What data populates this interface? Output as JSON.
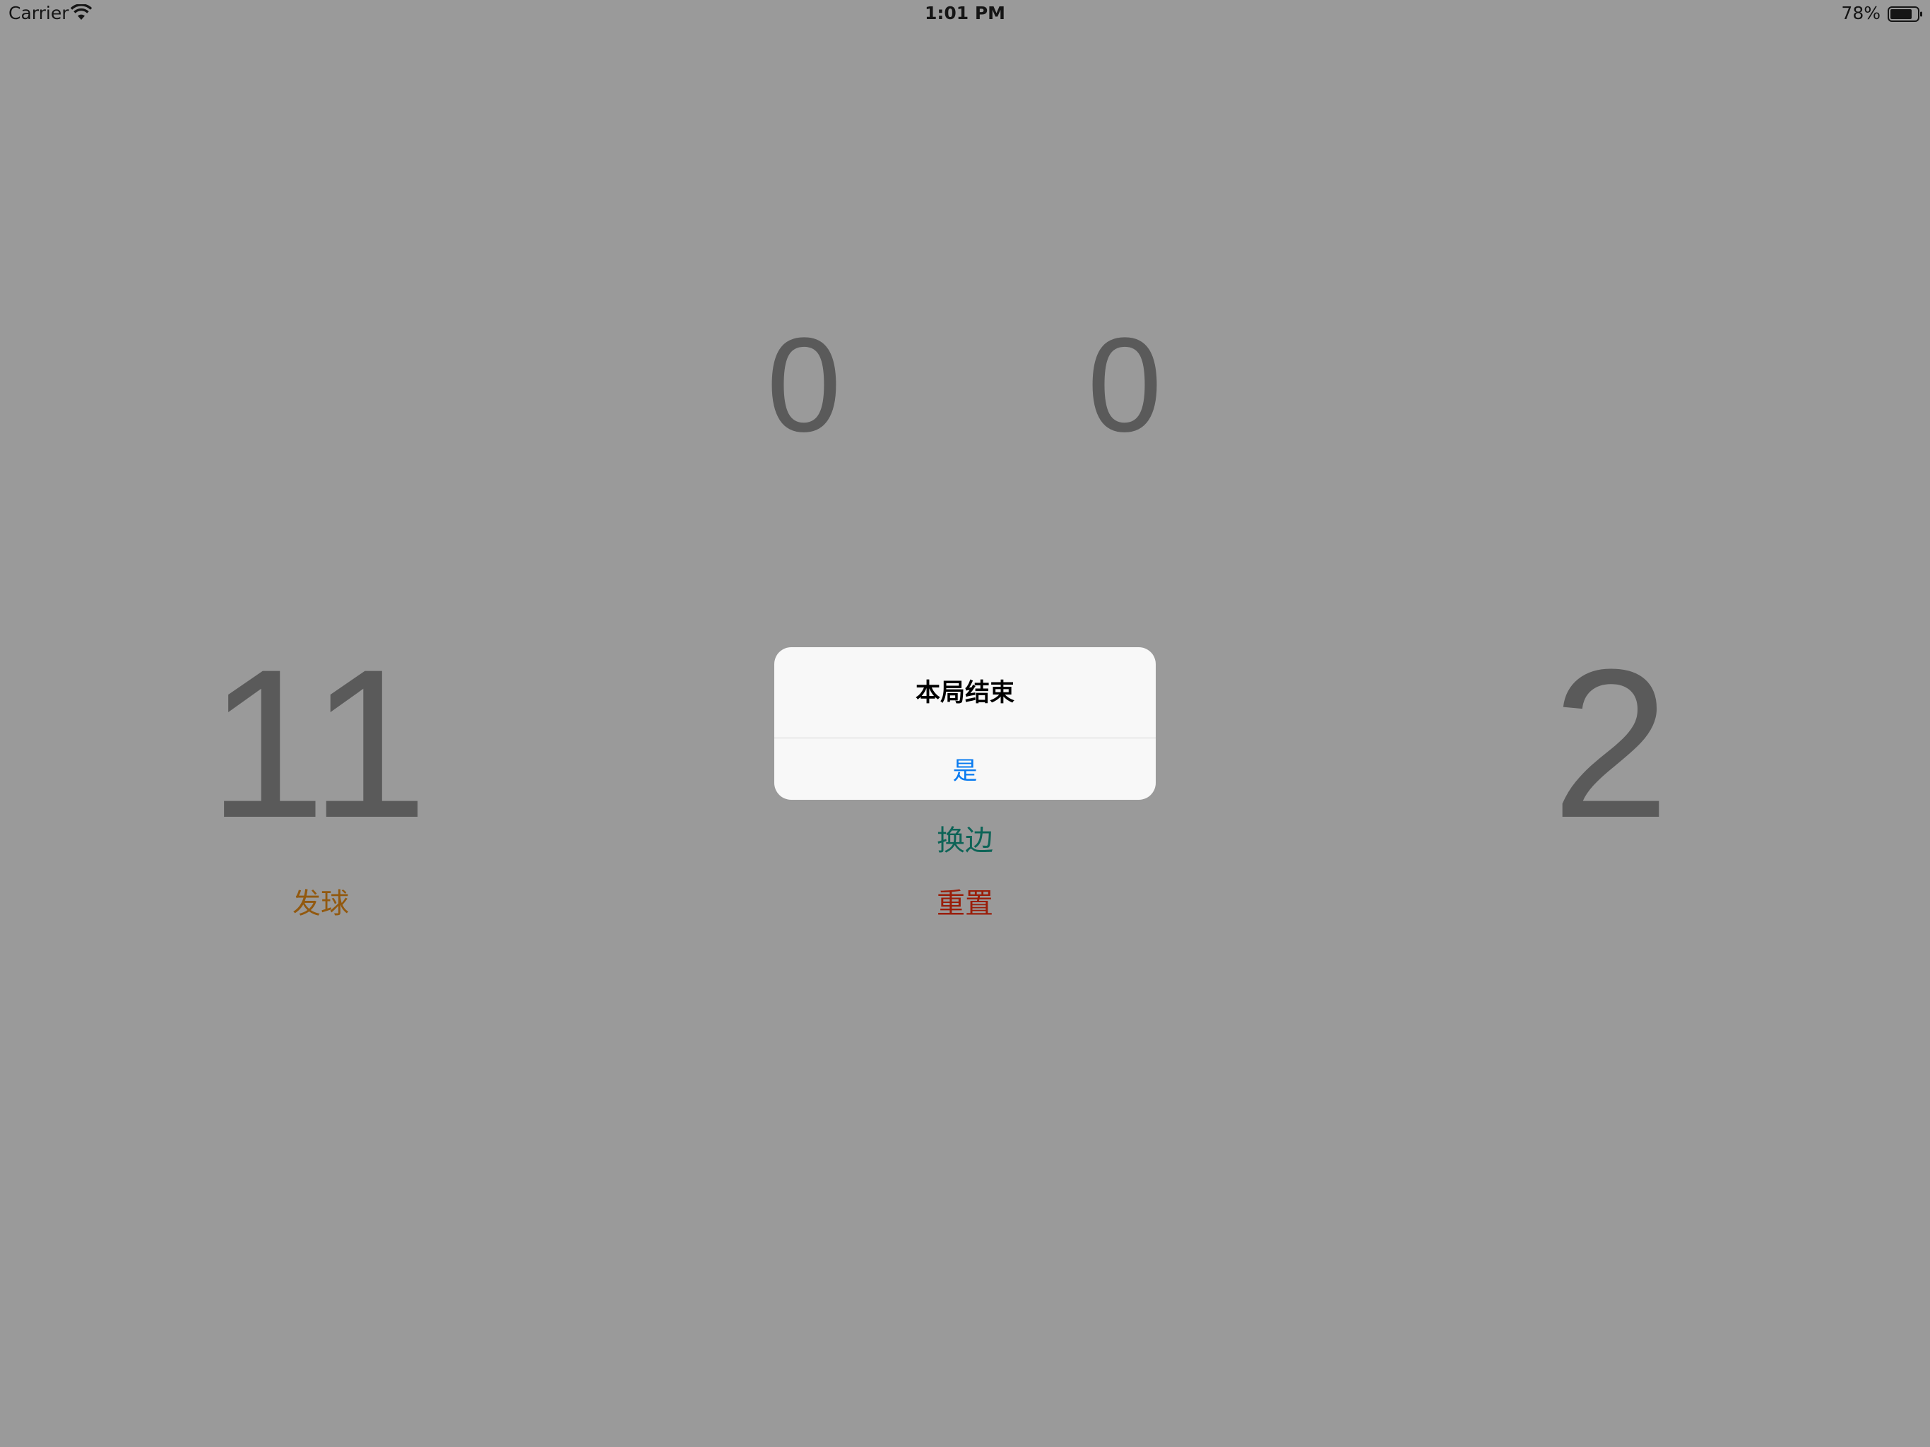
{
  "status_bar": {
    "carrier": "Carrier",
    "time": "1:01 PM",
    "battery": "78%",
    "battery_level": 0.78,
    "icons": [
      "wifi-icon",
      "battery-icon"
    ]
  },
  "scores": {
    "sets_left": "0",
    "sets_right": "0",
    "points_left": "11",
    "points_right": "2"
  },
  "actions": {
    "serve_label": "发球",
    "swap_label": "换边",
    "reset_label": "重置"
  },
  "alert": {
    "title": "本局结束",
    "confirm_label": "是"
  },
  "colors": {
    "background": "#9a9a9a",
    "score_text": "#5a5a5a",
    "serve": "#92590f",
    "swap": "#0d6457",
    "reset": "#9a1d09",
    "alert_button": "#0a7bf0"
  }
}
